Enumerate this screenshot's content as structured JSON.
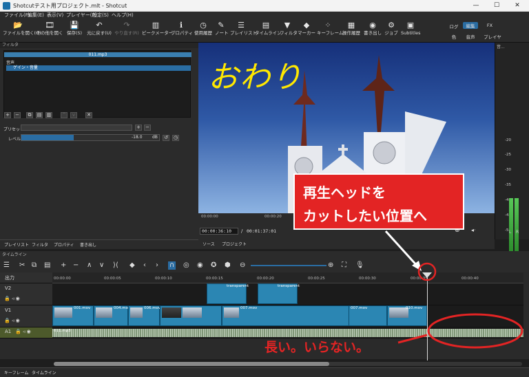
{
  "window": {
    "title": "Shotcutテスト用プロジェクト.mlt - Shotcut",
    "min": "—",
    "max": "☐",
    "close": "✕"
  },
  "menu": [
    "ファイル(F)",
    "編集(E)",
    "表示(V)",
    "プレイヤー(P)",
    "設定(S)",
    "ヘルプ(H)"
  ],
  "toolbar": [
    {
      "label": "ファイルを開く(O)",
      "icon": "📂"
    },
    {
      "label": "その他を開く",
      "icon": "🎞"
    },
    {
      "label": "保存(S)",
      "icon": "💾"
    },
    {
      "label": "元に戻す(U)",
      "icon": "↶"
    },
    {
      "label": "やり直す(R)",
      "icon": "↷"
    },
    {
      "label": "ピークメーター",
      "icon": "▥"
    },
    {
      "label": "プロパティ",
      "icon": "ℹ"
    },
    {
      "label": "使用履歴",
      "icon": "◷"
    },
    {
      "label": "ノート",
      "icon": "✎"
    },
    {
      "label": "プレイリスト",
      "icon": "☰"
    },
    {
      "label": "タイムライン",
      "icon": "▤"
    },
    {
      "label": "フィルタ",
      "icon": "▼"
    },
    {
      "label": "マーカー",
      "icon": "◆"
    },
    {
      "label": "キーフレーム",
      "icon": "⁘"
    },
    {
      "label": "操作履歴",
      "icon": "▦"
    },
    {
      "label": "書き出し",
      "icon": "◉"
    },
    {
      "label": "ジョブ",
      "icon": "⚙"
    },
    {
      "label": "Subtitles",
      "icon": "▣"
    }
  ],
  "layouts": {
    "row1": [
      "ログ",
      "編集",
      "FX"
    ],
    "row2": [
      "色",
      "音声",
      "プレイヤー"
    ]
  },
  "filters": {
    "header": "フィルタ",
    "clip_name": "011.mp3",
    "category": "音声",
    "item": "ゲイン・音量",
    "preset_label": "プリセット",
    "level_label": "レベル",
    "level_value": "-18.0",
    "level_unit": "dB"
  },
  "left_tabs": [
    "プレイリスト",
    "フィルタ",
    "プロパティ",
    "書き出し"
  ],
  "preview": {
    "overlay_text": "おわり"
  },
  "scrub_ticks": [
    "00:00:00",
    "00:00:20"
  ],
  "transport": {
    "current": "00:00:36:10",
    "separator": "/",
    "total": "00:01:37:01"
  },
  "mid_tabs": [
    "ソース",
    "プロジェクト"
  ],
  "meter": {
    "header": "音...",
    "ticks": [
      "-20",
      "-25",
      "-30",
      "-35",
      "-40",
      "-45",
      "-50"
    ],
    "channels": [
      "L",
      "R"
    ],
    "level_db": -20
  },
  "timeline": {
    "header": "タイムライン",
    "output_label": "出力",
    "ruler": [
      "00:00:00",
      "00:00:05",
      "00:00:10",
      "00:00:15",
      "00:00:20",
      "00:00:25",
      "00:00:30",
      "00:00:35",
      "00:00:40"
    ],
    "playhead_time": "00:00:35",
    "tracks": [
      {
        "name": "V2",
        "clips": [
          "transparent",
          "transparent"
        ]
      },
      {
        "name": "V1",
        "clips": [
          "001.mov",
          "004.mov",
          "006.mov",
          "007.mov",
          "007.mov",
          "010.mov"
        ]
      },
      {
        "name": "A1",
        "clips": [
          "011.mp3"
        ]
      }
    ]
  },
  "bottom_tabs": [
    "キーフレーム",
    "タイムライン"
  ],
  "annotations": {
    "callout_line1": "再生ヘッドを",
    "callout_line2": "カットしたい位置へ",
    "note": "長い。いらない。"
  }
}
